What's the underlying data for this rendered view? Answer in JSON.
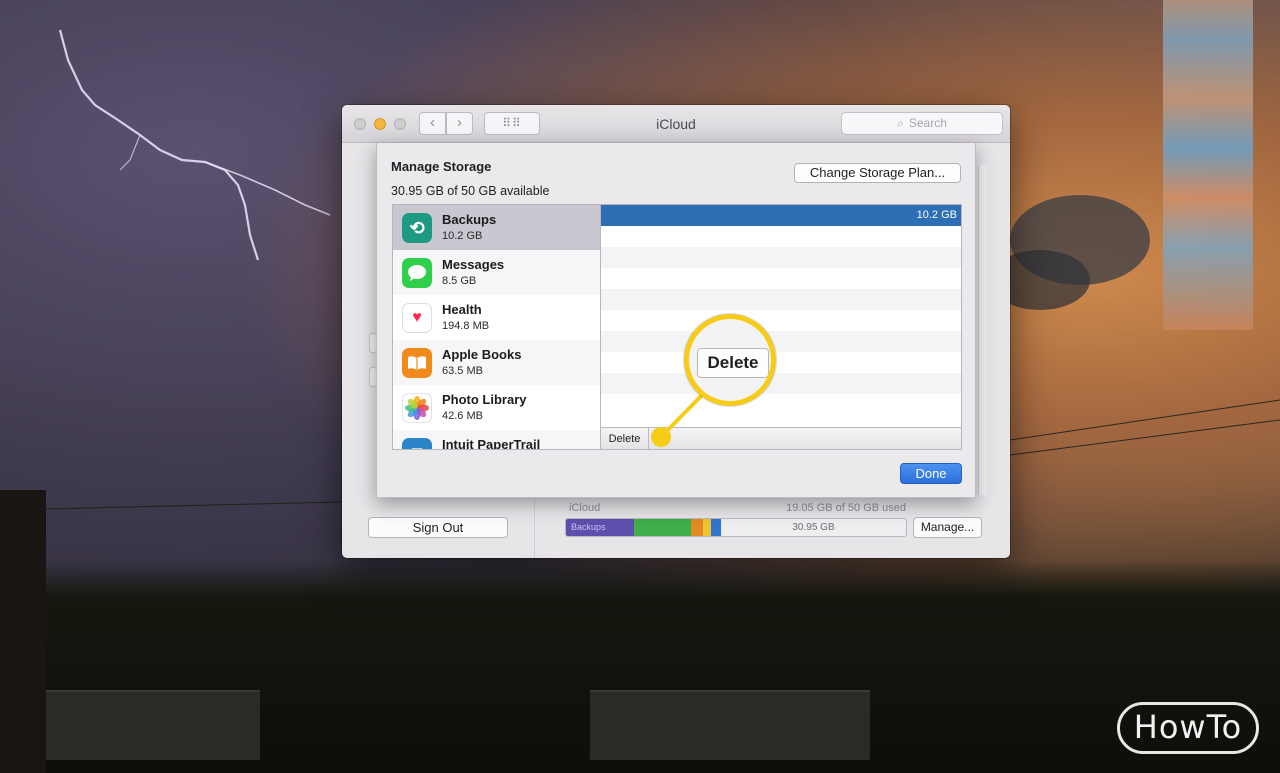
{
  "window": {
    "title": "iCloud",
    "search_placeholder": "Search",
    "nav_back": "‹",
    "nav_fwd": "›",
    "grid_glyph": "⠿⠿"
  },
  "account_pane": {
    "sign_out_label": "Sign Out",
    "icloud_label": "iCloud",
    "usage_text": "19.05 GB of 50 GB used",
    "bar_backups_label": "Backups",
    "bar_free_label": "30.95 GB",
    "manage_label": "Manage..."
  },
  "manage_storage": {
    "title": "Manage Storage",
    "available": "30.95 GB of 50 GB available",
    "change_plan_label": "Change Storage Plan...",
    "done_label": "Done",
    "apps": [
      {
        "name": "Backups",
        "size": "10.2 GB",
        "icon": "backup-icon"
      },
      {
        "name": "Messages",
        "size": "8.5 GB",
        "icon": "messages-icon"
      },
      {
        "name": "Health",
        "size": "194.8 MB",
        "icon": "heart-icon"
      },
      {
        "name": "Apple Books",
        "size": "63.5 MB",
        "icon": "book-icon"
      },
      {
        "name": "Photo Library",
        "size": "42.6 MB",
        "icon": "photos-icon"
      },
      {
        "name": "Intuit PaperTrail",
        "size": "",
        "icon": "papertrail-icon"
      }
    ],
    "detail_selected_size": "10.2 GB",
    "delete_label": "Delete"
  },
  "callout": {
    "delete_label": "Delete",
    "color": "#f6cc17"
  },
  "watermark": {
    "text": "HowTo"
  },
  "colors": {
    "selection_blue": "#2e6eb5",
    "done_blue": "#2a6fdb",
    "backups_purple": "#5e4fae",
    "messages_green": "#3fae4b"
  }
}
